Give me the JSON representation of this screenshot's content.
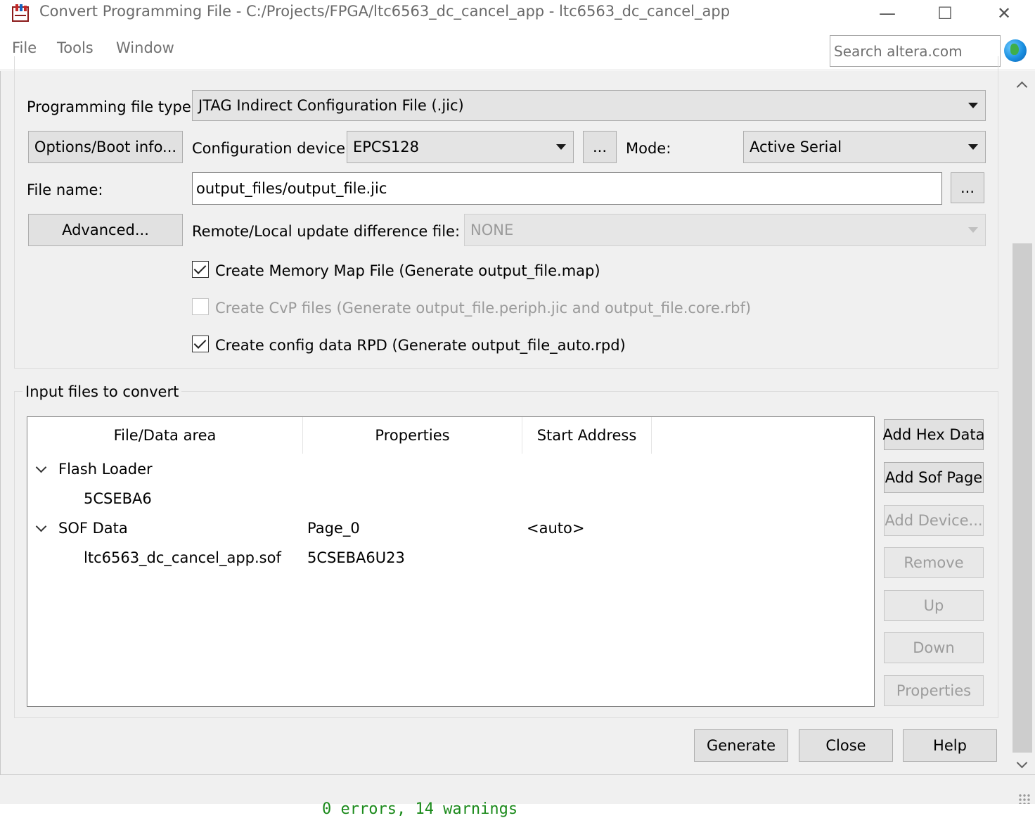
{
  "window": {
    "title": "Convert Programming File - C:/Projects/FPGA/ltc6563_dc_cancel_app - ltc6563_dc_cancel_app",
    "minimize_glyph": "—",
    "maximize_glyph": "☐",
    "close_glyph": "✕"
  },
  "menu": {
    "items": [
      "File",
      "Tools",
      "Window"
    ],
    "search_placeholder": "Search altera.com"
  },
  "output": {
    "file_type_label": "Programming file type:",
    "file_type_value": "JTAG Indirect Configuration File (.jic)",
    "options_button": "Options/Boot info...",
    "config_device_label": "Configuration device:",
    "config_device_value": "EPCS128",
    "browse_device_button": "...",
    "mode_label": "Mode:",
    "mode_value": "Active Serial",
    "file_name_label": "File name:",
    "file_name_value": "output_files/output_file.jic",
    "browse_file_button": "...",
    "advanced_button": "Advanced...",
    "remote_label": "Remote/Local update difference file:",
    "remote_value": "NONE",
    "checkboxes": [
      {
        "label": "Create Memory Map File (Generate output_file.map)",
        "checked": true,
        "enabled": true
      },
      {
        "label": "Create CvP files (Generate output_file.periph.jic and output_file.core.rbf)",
        "checked": false,
        "enabled": false
      },
      {
        "label": "Create config data RPD (Generate output_file_auto.rpd)",
        "checked": true,
        "enabled": true
      }
    ]
  },
  "input_files": {
    "title": "Input files to convert",
    "columns": [
      "File/Data area",
      "Properties",
      "Start Address"
    ],
    "rows": [
      {
        "name": "Flash Loader",
        "properties": "",
        "start": ""
      },
      {
        "name": "5CSEBA6",
        "properties": "",
        "start": ""
      },
      {
        "name": "SOF Data",
        "properties": "Page_0",
        "start": "<auto>"
      },
      {
        "name": "ltc6563_dc_cancel_app.sof",
        "properties": "5CSEBA6U23",
        "start": ""
      }
    ],
    "side_buttons": [
      {
        "label": "Add Hex Data",
        "enabled": true
      },
      {
        "label": "Add Sof Page",
        "enabled": true
      },
      {
        "label": "Add Device...",
        "enabled": false
      },
      {
        "label": "Remove",
        "enabled": false
      },
      {
        "label": "Up",
        "enabled": false
      },
      {
        "label": "Down",
        "enabled": false
      },
      {
        "label": "Properties",
        "enabled": false
      }
    ]
  },
  "footer": {
    "generate": "Generate",
    "close": "Close",
    "help": "Help"
  },
  "console": {
    "text": "0 errors, 14 warnings"
  }
}
